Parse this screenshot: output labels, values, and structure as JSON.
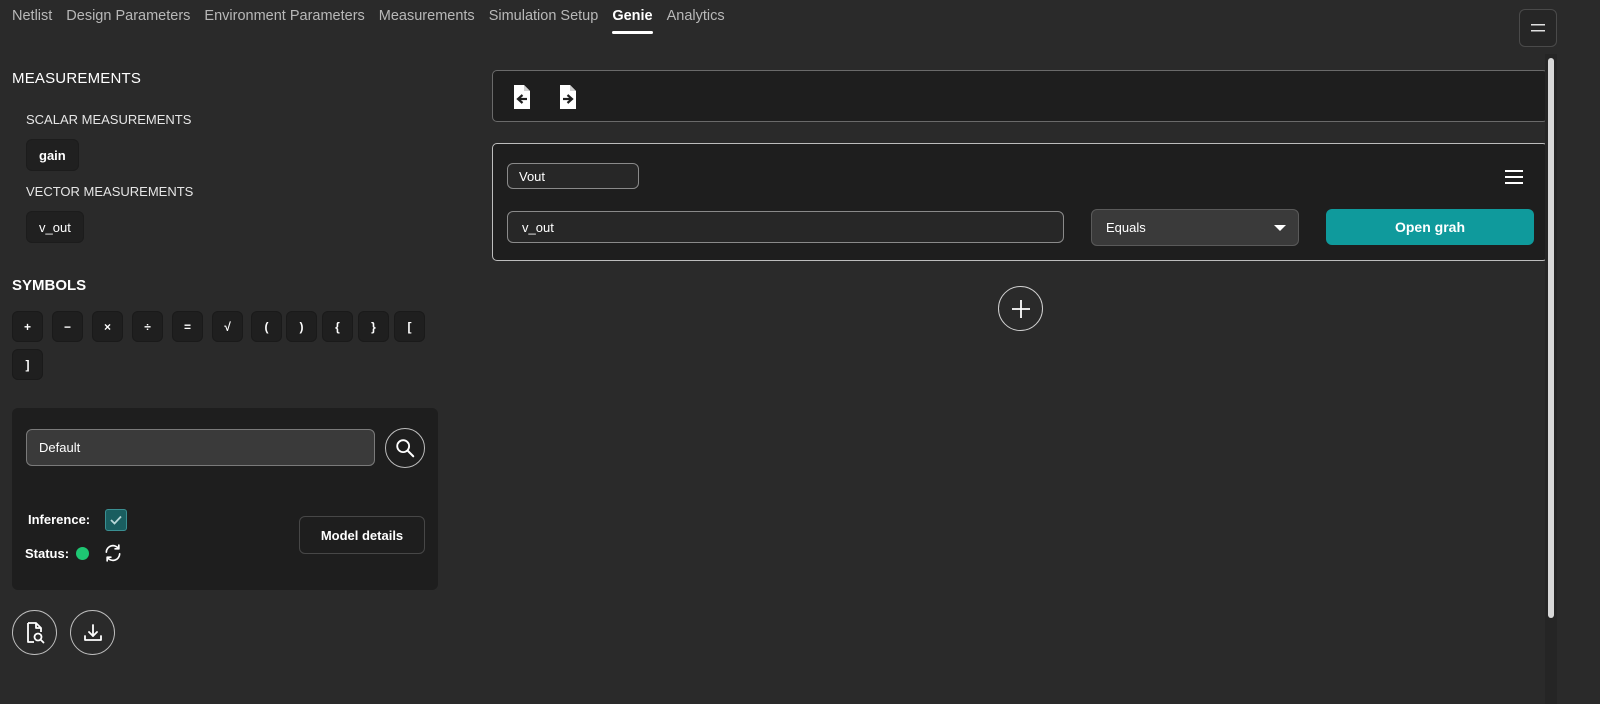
{
  "tabs": [
    {
      "label": "Netlist",
      "active": false
    },
    {
      "label": "Design Parameters",
      "active": false
    },
    {
      "label": "Environment Parameters",
      "active": false
    },
    {
      "label": "Measurements",
      "active": false
    },
    {
      "label": "Simulation Setup",
      "active": false
    },
    {
      "label": "Genie",
      "active": true
    },
    {
      "label": "Analytics",
      "active": false
    }
  ],
  "sidebar": {
    "measurements_title": "MEASUREMENTS",
    "scalar_title": "SCALAR MEASUREMENTS",
    "scalar_items": [
      "gain"
    ],
    "vector_title": "VECTOR MEASUREMENTS",
    "vector_items": [
      "v_out"
    ],
    "symbols_title": "SYMBOLS",
    "symbols": [
      "+",
      "−",
      "×",
      "÷",
      "=",
      "√",
      "(",
      ")",
      "{",
      "}",
      "[",
      "]"
    ]
  },
  "model": {
    "value": "Default",
    "inference_label": "Inference:",
    "inference_checked": true,
    "status_label": "Status:",
    "status_color": "#1ec773",
    "details_button": "Model details"
  },
  "card": {
    "name_value": "Vout",
    "expression_value": "v_out",
    "condition_selected": "Equals",
    "graph_button": "Open grah"
  },
  "colors": {
    "accent": "#0f9a9c",
    "background": "#2a2a2a",
    "panel": "#1e1e1e"
  },
  "icons": {
    "menu": "equals-menu-icon",
    "toolbar": [
      "file-import-icon",
      "file-export-icon"
    ],
    "search": "search-icon",
    "refresh": "refresh-icon",
    "add": "plus-icon",
    "bottom": [
      "file-search-icon",
      "download-icon"
    ]
  }
}
